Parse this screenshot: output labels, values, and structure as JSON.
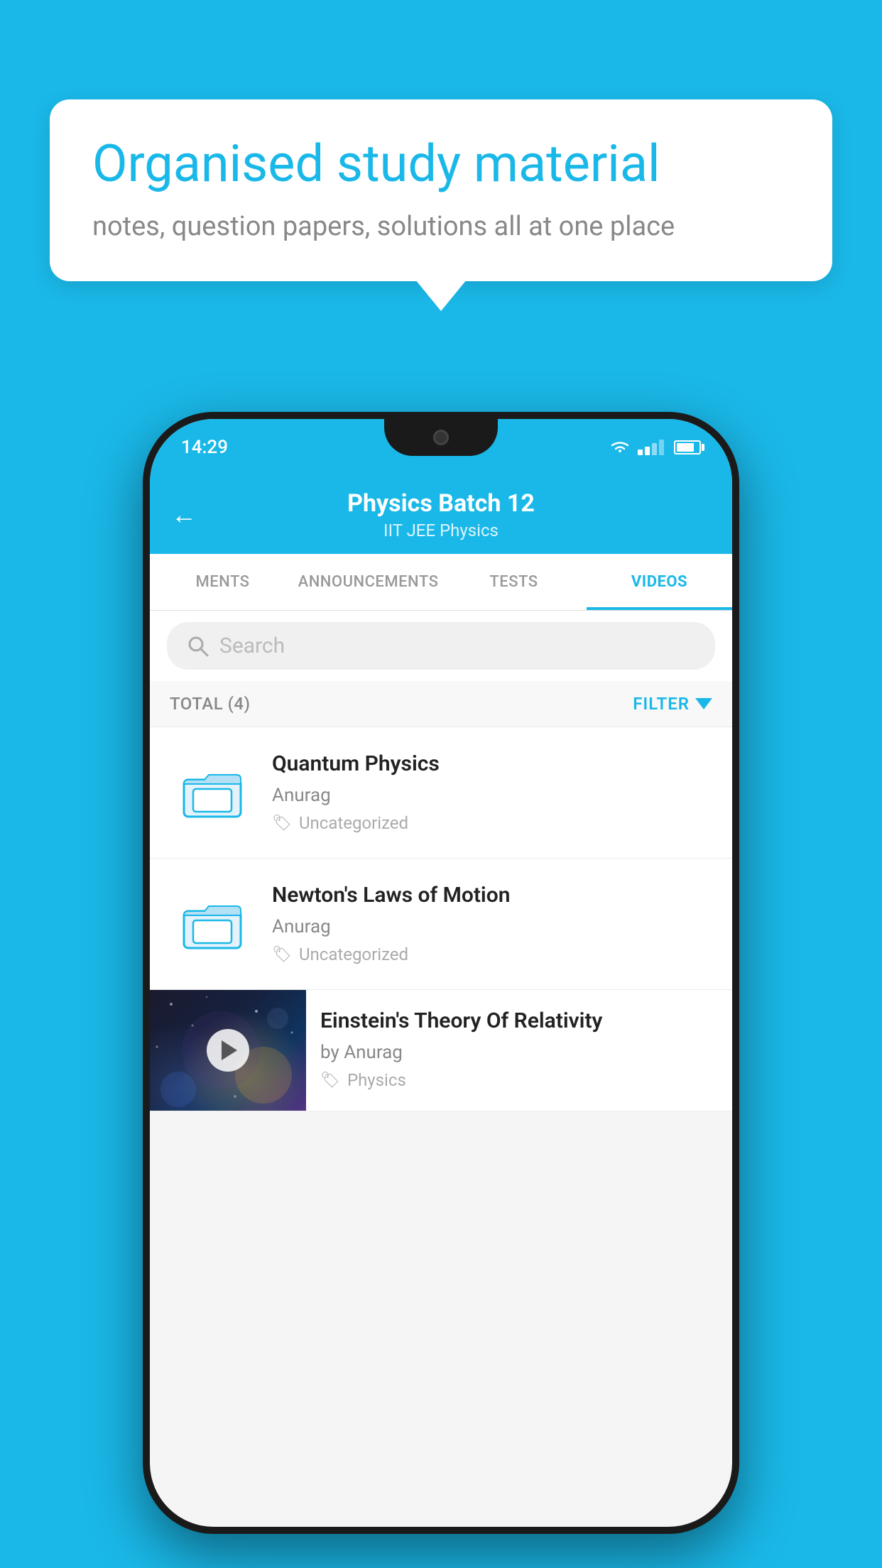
{
  "background_color": "#1ab8e8",
  "bubble": {
    "title": "Organised study material",
    "subtitle": "notes, question papers, solutions all at one place"
  },
  "status_bar": {
    "time": "14:29"
  },
  "header": {
    "back_label": "←",
    "title": "Physics Batch 12",
    "subtitle": "IIT JEE   Physics"
  },
  "tabs": [
    {
      "label": "MENTS",
      "active": false
    },
    {
      "label": "ANNOUNCEMENTS",
      "active": false
    },
    {
      "label": "TESTS",
      "active": false
    },
    {
      "label": "VIDEOS",
      "active": true
    }
  ],
  "search": {
    "placeholder": "Search"
  },
  "filter_bar": {
    "total_label": "TOTAL (4)",
    "filter_label": "FILTER"
  },
  "videos": [
    {
      "title": "Quantum Physics",
      "author": "Anurag",
      "tag": "Uncategorized",
      "has_thumb": false
    },
    {
      "title": "Newton's Laws of Motion",
      "author": "Anurag",
      "tag": "Uncategorized",
      "has_thumb": false
    },
    {
      "title": "Einstein's Theory Of Relativity",
      "author": "by Anurag",
      "tag": "Physics",
      "has_thumb": true
    }
  ]
}
